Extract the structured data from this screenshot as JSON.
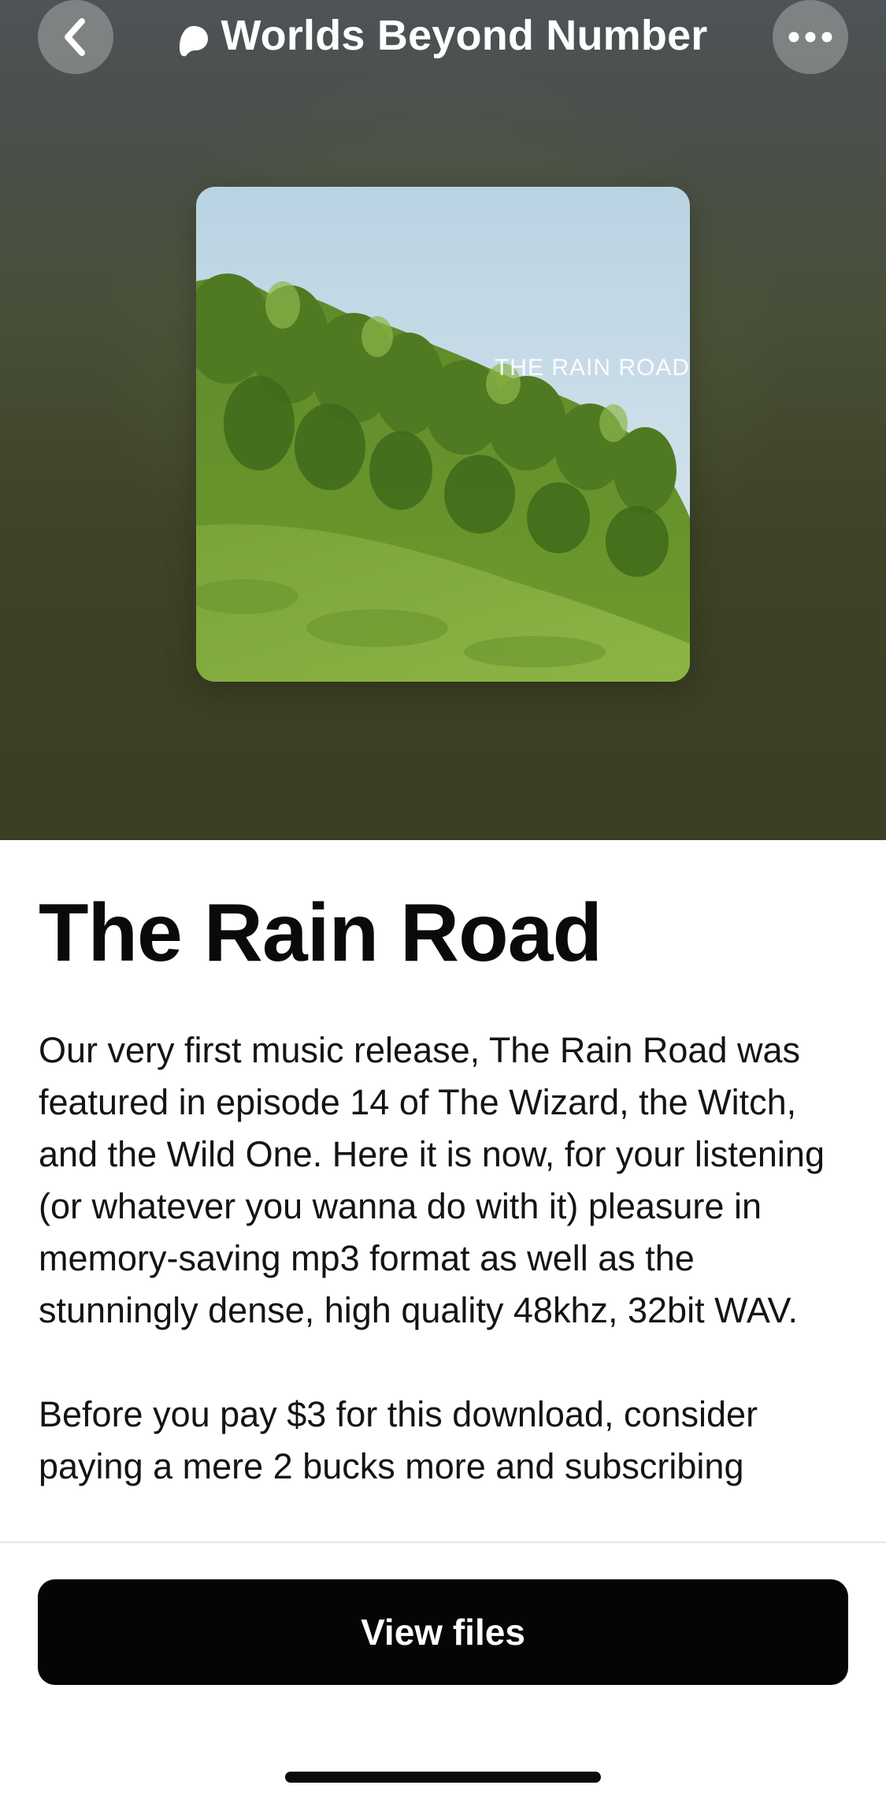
{
  "header": {
    "creator_name": "Worlds Beyond Number",
    "icons": {
      "back": "chevron-left-icon",
      "creator_logo": "patreon-logo-icon",
      "more": "ellipsis-icon"
    }
  },
  "artwork": {
    "overlay_text": "THE RAIN ROAD"
  },
  "post": {
    "title": "The Rain Road",
    "paragraphs": [
      "Our very first music release, The Rain Road was featured in episode 14 of The Wizard, the Witch, and the Wild One. Here it is now, for your listening (or whatever you wanna do with it) pleasure in memory-saving mp3 format as well as the stunningly dense, high quality 48khz, 32bit WAV.",
      "Before you pay $3 for this download, consider paying a mere 2 bucks more and subscribing"
    ]
  },
  "actions": {
    "view_files_label": "View files"
  },
  "colors": {
    "button_bg": "#050505",
    "button_text": "#ffffff",
    "hero_top": "#4d5357",
    "hero_bottom": "#3a4023"
  }
}
